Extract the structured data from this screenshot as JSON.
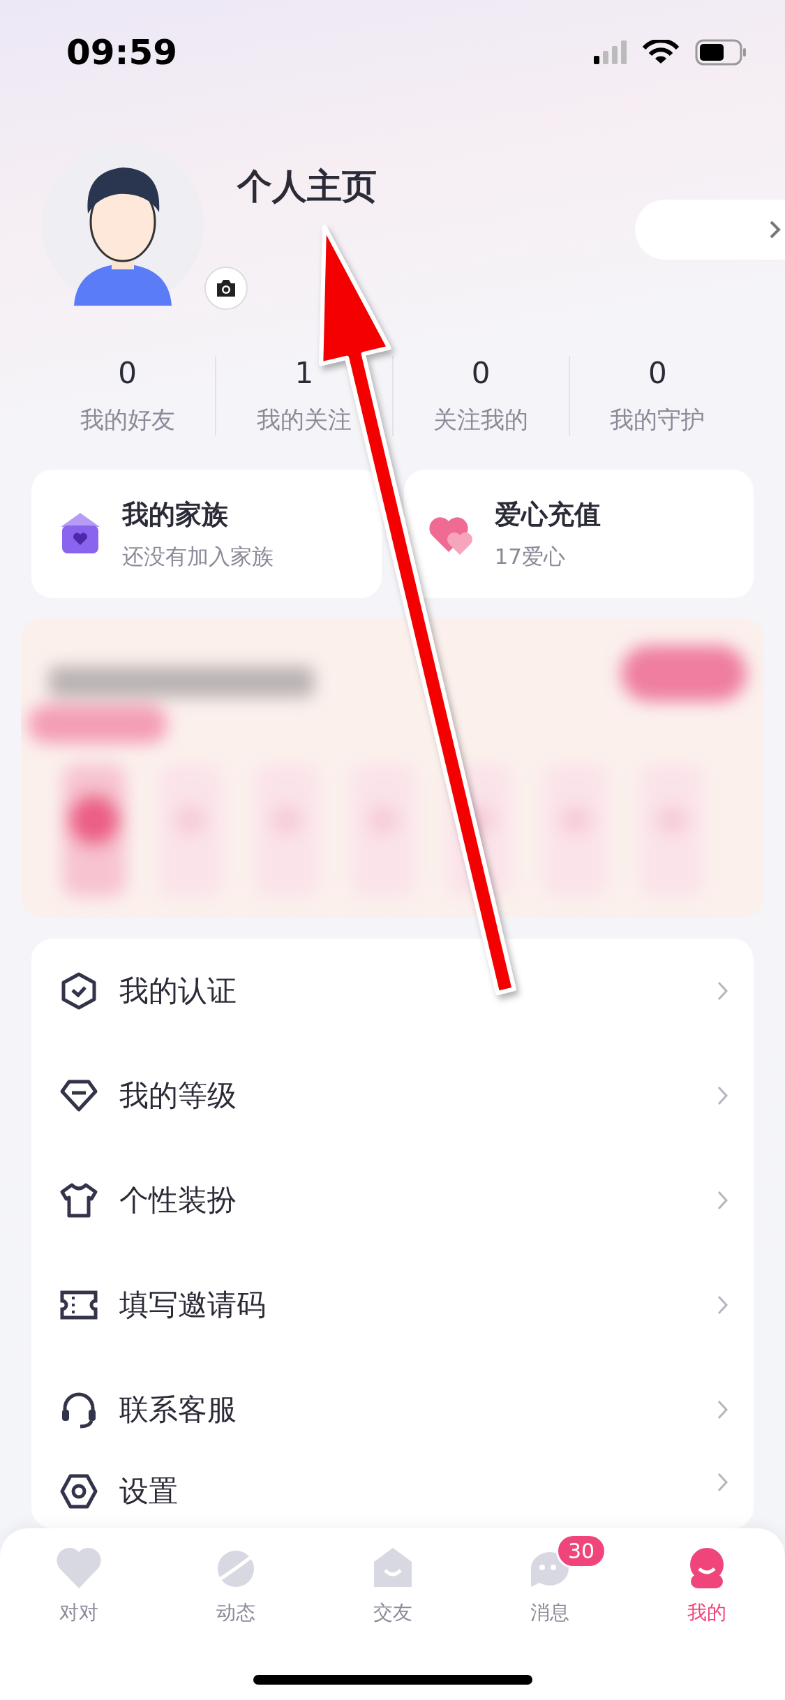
{
  "status_bar": {
    "time": "09:59"
  },
  "profile": {
    "title": "个人主页"
  },
  "stats": [
    {
      "value": "0",
      "label": "我的好友"
    },
    {
      "value": "1",
      "label": "我的关注"
    },
    {
      "value": "0",
      "label": "关注我的"
    },
    {
      "value": "0",
      "label": "我的守护"
    }
  ],
  "cards": [
    {
      "kind": "family",
      "title": "我的家族",
      "subtitle": "还没有加入家族"
    },
    {
      "kind": "recharge",
      "title": "爱心充值",
      "subtitle": "17爱心"
    }
  ],
  "menu": [
    {
      "label": "我的认证"
    },
    {
      "label": "我的等级"
    },
    {
      "label": "个性装扮"
    },
    {
      "label": "填写邀请码"
    },
    {
      "label": "联系客服"
    },
    {
      "label": "设置"
    }
  ],
  "tab_bar": [
    {
      "label": "对对",
      "selected": false
    },
    {
      "label": "动态",
      "selected": false
    },
    {
      "label": "交友",
      "selected": false
    },
    {
      "label": "消息",
      "selected": false,
      "badge": "30"
    },
    {
      "label": "我的",
      "selected": true
    }
  ]
}
